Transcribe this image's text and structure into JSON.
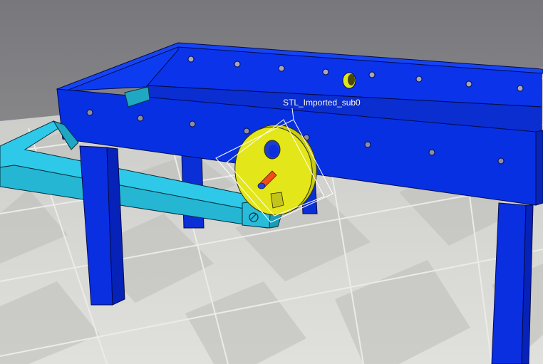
{
  "viewport": {
    "selected_object_label": "STL_Imported_sub0"
  },
  "colors": {
    "table": "#0a2fe0",
    "frame": "#2ec9e8",
    "disc": "#e3e619",
    "shaft": "#f24a1a",
    "floor_light": "#d9d9d6",
    "floor_dark": "#bdbdb9",
    "sky": "#7f7f82",
    "selection": "#ffffff"
  }
}
